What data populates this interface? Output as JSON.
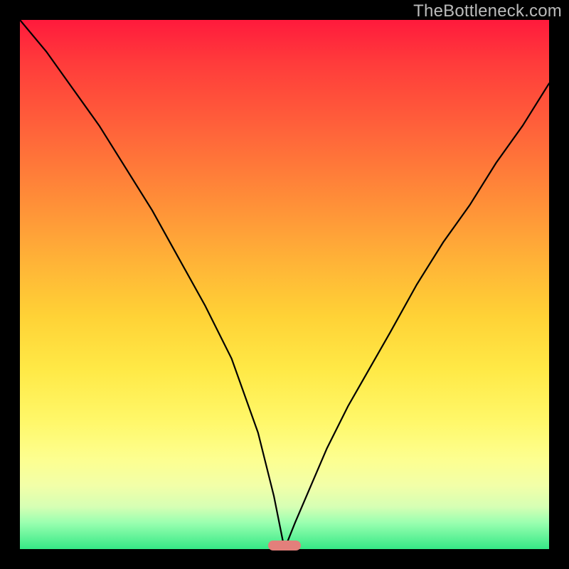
{
  "watermark_text": "TheBottleneck.com",
  "chart_data": {
    "type": "line",
    "title": "",
    "xlabel": "",
    "ylabel": "",
    "xlim": [
      0,
      100
    ],
    "ylim": [
      0,
      100
    ],
    "grid": false,
    "legend": false,
    "series": [
      {
        "name": "curve",
        "x": [
          0,
          5,
          10,
          15,
          20,
          25,
          30,
          35,
          40,
          45,
          48,
          50,
          52,
          55,
          58,
          62,
          66,
          70,
          75,
          80,
          85,
          90,
          95,
          100
        ],
        "values": [
          100,
          94,
          87,
          80,
          72,
          64,
          55,
          46,
          36,
          22,
          10,
          0,
          5,
          12,
          19,
          27,
          34,
          41,
          50,
          58,
          65,
          73,
          80,
          88
        ]
      }
    ],
    "background_gradient": {
      "top_color": "#ff1a3c",
      "mid_colors": [
        "#ff9a38",
        "#ffe946"
      ],
      "bottom_color": "#35e986"
    },
    "trough": {
      "x": 50,
      "y": 0,
      "marker_color": "#e37f7b"
    }
  }
}
